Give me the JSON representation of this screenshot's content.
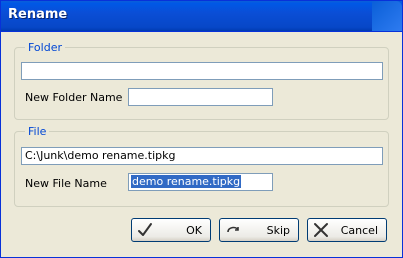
{
  "window": {
    "title": "Rename"
  },
  "folder_group": {
    "legend": "Folder",
    "path_value": "",
    "new_name_label": "New Folder Name",
    "new_name_value": ""
  },
  "file_group": {
    "legend": "File",
    "path_value": "C:\\Junk\\demo rename.tipkg",
    "new_name_label": "New File Name",
    "new_name_value": "demo rename.tipkg"
  },
  "buttons": {
    "ok": "OK",
    "skip": "Skip",
    "cancel": "Cancel"
  },
  "icons": {
    "ok": "checkmark-icon",
    "skip": "skip-arrow-icon",
    "cancel": "cancel-x-icon"
  },
  "colors": {
    "title_bar": "#0a4ed6",
    "legend_text": "#0046d5",
    "selection": "#316ac5",
    "field_border": "#7f9db9"
  }
}
